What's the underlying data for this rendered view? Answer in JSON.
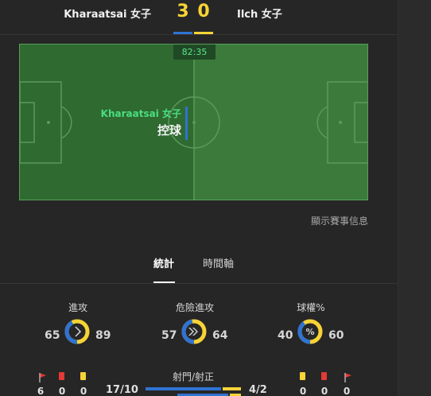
{
  "header": {
    "home_team": "Kharaatsai 女子",
    "away_team": "Ilch 女子",
    "home_score": "3",
    "away_score": "0"
  },
  "pitch": {
    "timer": "82:35",
    "possession_team": "Kharaatsai 女子",
    "possession_label": "控球"
  },
  "event_info_link": "顯示賽事信息",
  "tabs": [
    {
      "label": "統計",
      "active": true
    },
    {
      "label": "時間軸",
      "active": false
    }
  ],
  "stats": [
    {
      "label": "進攻",
      "home": "65",
      "away": "89",
      "icon": "chevron-right-icon",
      "home_share": 0.42
    },
    {
      "label": "危險進攻",
      "home": "57",
      "away": "64",
      "icon": "double-chevron-icon",
      "home_share": 0.47
    },
    {
      "label": "球權%",
      "home": "40",
      "away": "60",
      "icon": "percent-icon",
      "home_share": 0.4
    }
  ],
  "cards": {
    "home": {
      "corners": "6",
      "red": "0",
      "yellow": "0"
    },
    "away": {
      "yellow": "0",
      "red": "0",
      "corners": "0"
    }
  },
  "shots": {
    "label": "射門/射正",
    "home": "17/10",
    "away": "4/2",
    "home_shots_share": 0.81,
    "home_on_target_share": 0.83
  },
  "colors": {
    "home": "#2f73d3",
    "away": "#f7d337",
    "pitch": "#3c7a3c",
    "possession_text": "#4ade80"
  }
}
